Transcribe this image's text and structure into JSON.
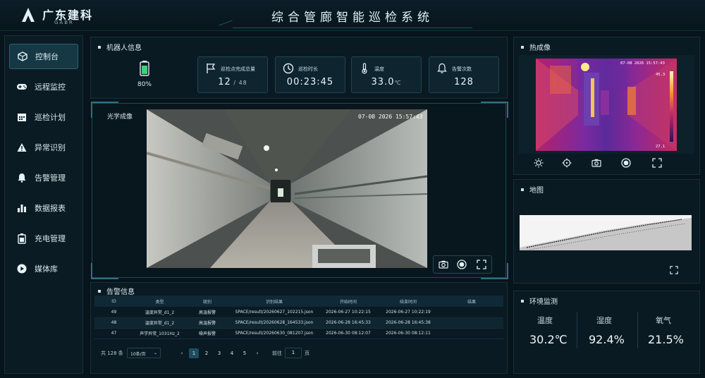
{
  "header": {
    "brand": "广东建科",
    "brand_en": "GABR",
    "title": "综合管廊智能巡检系统"
  },
  "sidebar": {
    "items": [
      {
        "label": "控制台",
        "icon": "cube-icon",
        "active": true
      },
      {
        "label": "远程监控",
        "icon": "gamepad-icon",
        "active": false
      },
      {
        "label": "巡检计划",
        "icon": "calendar-icon",
        "active": false
      },
      {
        "label": "异常识别",
        "icon": "warning-icon",
        "active": false
      },
      {
        "label": "告警管理",
        "icon": "bell-icon",
        "active": false
      },
      {
        "label": "数据报表",
        "icon": "bar-chart-icon",
        "active": false
      },
      {
        "label": "充电管理",
        "icon": "battery-icon",
        "active": false
      },
      {
        "label": "媒体库",
        "icon": "play-icon",
        "active": false
      }
    ]
  },
  "robot": {
    "title": "机器人信息",
    "battery": "80%",
    "battery_level": 0.8,
    "cards": [
      {
        "label": "巡检点完成总量",
        "value": "12",
        "suffix": " / 48",
        "icon": "flag-icon"
      },
      {
        "label": "巡检时长",
        "value": "00:23:45",
        "suffix": "",
        "icon": "clock-icon"
      },
      {
        "label": "温度",
        "value": "33.0",
        "suffix": "℃",
        "icon": "thermometer-icon"
      },
      {
        "label": "告警次数",
        "value": "128",
        "suffix": "",
        "icon": "bell-icon"
      }
    ]
  },
  "optical": {
    "title": "光学成像",
    "timestamp": "07-08 2026 15:57:43"
  },
  "thermal": {
    "title": "热成像",
    "timestamp": "07-08 2026 15:57:43",
    "max_temp": "45.3",
    "min_temp": "27.1"
  },
  "map": {
    "title": "地图"
  },
  "environment": {
    "title": "环境监测",
    "items": [
      {
        "label": "温度",
        "value": "30.2℃"
      },
      {
        "label": "湿度",
        "value": "92.4%"
      },
      {
        "label": "氧气",
        "value": "21.5%"
      }
    ]
  },
  "alarm": {
    "title": "告警信息",
    "columns": [
      "ID",
      "类型",
      "级别",
      "识别结果",
      "开始时间",
      "结束时间",
      "结果"
    ],
    "rows": [
      [
        "49",
        "温度异常_d1_2",
        "高温报警",
        "SPACE/result/20260627_102215.json",
        "2026-06-27 10:22:15",
        "2026-06-27 10:22:19",
        ""
      ],
      [
        "48",
        "温度异常_d1_2",
        "高温报警",
        "SPACE/result/20260628_164533.json",
        "2026-06-28 16:45:33",
        "2026-06-28 16:45:38",
        ""
      ],
      [
        "47",
        "声学异常_1031Hz_2",
        "噪声报警",
        "SPACE/result/20260630_081207.json",
        "2026-06-30 08:12:07",
        "2026-06-30 08:12:11",
        ""
      ]
    ],
    "pager": {
      "total": "共 128 条",
      "page_size": "10条/页",
      "pages": [
        "1",
        "2",
        "3",
        "4",
        "5"
      ],
      "current": "1",
      "goto_label": "前往",
      "goto_value": "1",
      "page_suffix": "页",
      "prev": "‹",
      "next": "›"
    }
  },
  "colors": {
    "background": "#07141b",
    "panel": "#0a1a22",
    "accent": "#2a6272",
    "battery": "#41d07a"
  }
}
